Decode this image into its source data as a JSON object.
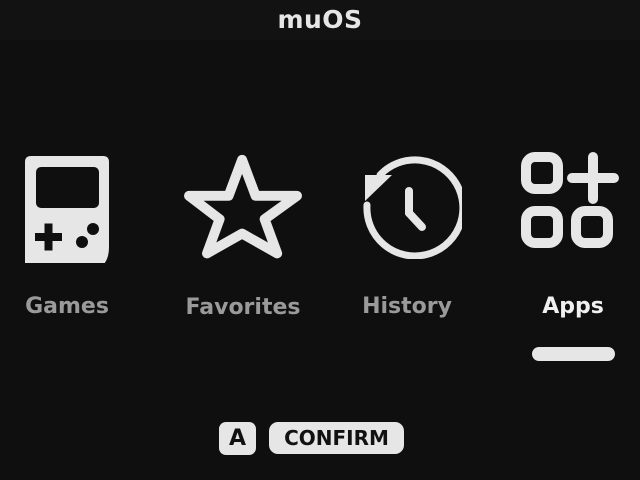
{
  "header": {
    "title": "muOS"
  },
  "menu": {
    "items": [
      {
        "label": "Games",
        "icon": "gameboy-icon",
        "selected": false
      },
      {
        "label": "Favorites",
        "icon": "star-icon",
        "selected": false
      },
      {
        "label": "History",
        "icon": "history-icon",
        "selected": false
      },
      {
        "label": "Apps",
        "icon": "apps-grid-icon",
        "selected": true
      }
    ]
  },
  "footer": {
    "button_glyph": "A",
    "action_label": "CONFIRM"
  },
  "colors": {
    "background": "#0f0f0f",
    "header_background": "#121212",
    "foreground": "#e6e6e6",
    "dim_text": "#9a9a9a"
  }
}
